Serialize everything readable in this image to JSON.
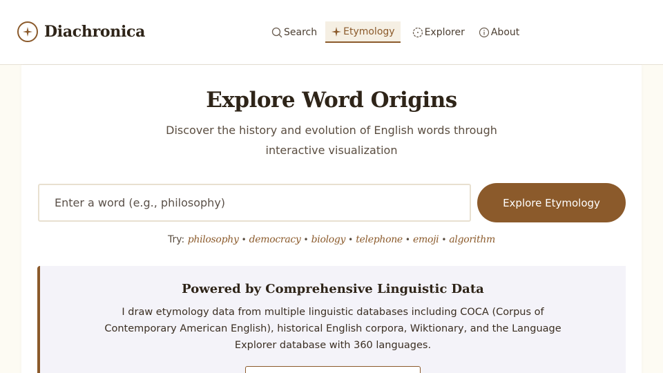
{
  "header": {
    "brand": "Diachronica",
    "nav": [
      {
        "label": "Search",
        "icon": "search-icon"
      },
      {
        "label": "Etymology",
        "icon": "sparkle-icon",
        "active": true
      },
      {
        "label": "Explorer",
        "icon": "compass-icon"
      },
      {
        "label": "About",
        "icon": "info-icon"
      }
    ]
  },
  "hero": {
    "title": "Explore Word Origins",
    "subtitle": "Discover the history and evolution of English words through interactive visualization"
  },
  "search": {
    "placeholder": "Enter a word (e.g., philosophy)",
    "value": "",
    "button_label": "Explore Etymology"
  },
  "suggestions": {
    "label": "Try:",
    "words": [
      "philosophy",
      "democracy",
      "biology",
      "telephone",
      "emoji",
      "algorithm"
    ],
    "separator": "•"
  },
  "info": {
    "title": "Powered by Comprehensive Linguistic Data",
    "body": "I draw etymology data from multiple linguistic databases including COCA (Corpus of Contemporary American English), historical English corpora, Wiktionary, and the Language Explorer database with 360 languages."
  },
  "colors": {
    "accent": "#8b5a2b",
    "background": "#fdfbf3",
    "info_bg": "#f4f3f9"
  }
}
